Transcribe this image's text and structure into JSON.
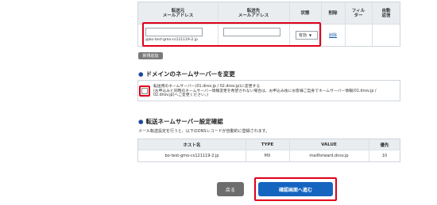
{
  "forwarding_table": {
    "headers": {
      "source": "転送元\nメールアドレス",
      "dest": "転送先\nメールアドレス",
      "status": "状態",
      "delete": "削除",
      "filter": "フィル\nター",
      "auto_reply": "自動\n返信"
    },
    "row": {
      "source_value": "",
      "source_domain": "@bo-test-gmo-cs121119-2.jp",
      "dest_value": "",
      "status_value": "有効",
      "delete_link": "削除"
    },
    "add_new_label": "新規追加"
  },
  "nameserver_section": {
    "title": "ドメインのネームサーバーを変更",
    "notice": "転送用のネームサーバー(01.dnsv.jp / 02.dnsv.jp)に変更する\n(お申込みと同時のネームサーバー情報変更を希望されない場合は、お申込み後にお客様ご自身でネームサーバー情報(01.dnsv.jp / 02.dnsv.jp)へご変更ください。)"
  },
  "dns_section": {
    "title": "転送ネームサーバー設定確認",
    "description": "メール転送設定を行うと、以下のDNSレコードが自動的に登録されます。",
    "headers": [
      "ホスト名",
      "TYPE",
      "VALUE",
      "優先"
    ],
    "row": [
      "bo-test-gmo-cs121119-2.jp",
      "MX",
      "mailforward.dnsv.jp",
      "10"
    ]
  },
  "buttons": {
    "back": "戻る",
    "confirm": "確認画面へ進む"
  },
  "colors": {
    "highlight": "#e0001b",
    "primary": "#1565c0"
  }
}
